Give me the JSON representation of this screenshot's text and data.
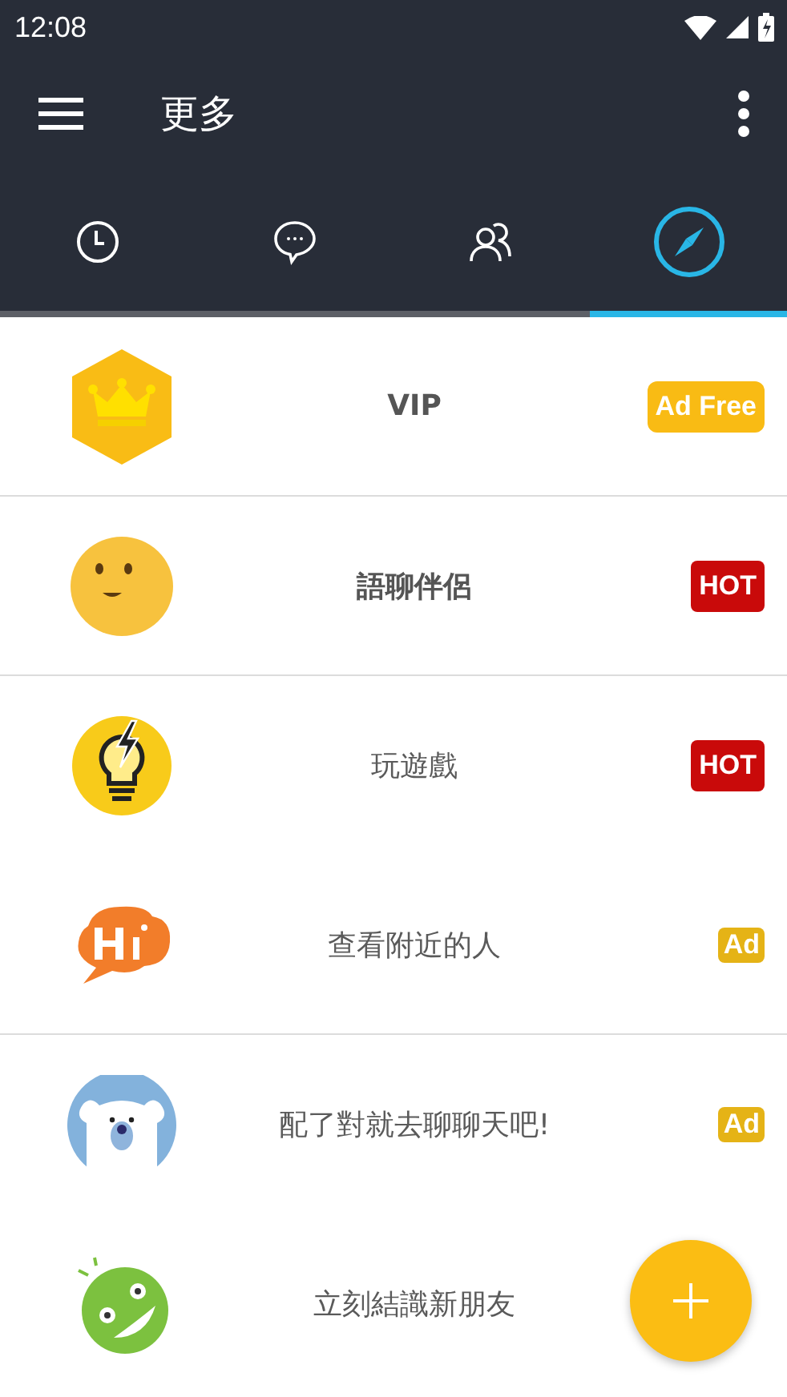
{
  "status_bar": {
    "time": "12:08"
  },
  "toolbar": {
    "title": "更多"
  },
  "tabs": [
    {
      "selected": false
    },
    {
      "selected": false
    },
    {
      "selected": false
    },
    {
      "selected": true
    }
  ],
  "rows": [
    {
      "label": "VIP",
      "bold": true,
      "badge": {
        "kind": "adfree",
        "text": "Ad Free"
      },
      "divider": true
    },
    {
      "label": "語聊伴侶",
      "bold": true,
      "badge": {
        "kind": "hot",
        "text": "HOT"
      },
      "divider": true
    },
    {
      "label": "玩遊戲",
      "bold": false,
      "badge": {
        "kind": "hot",
        "text": "HOT"
      },
      "divider": false
    },
    {
      "label": "查看附近的人",
      "bold": false,
      "badge": {
        "kind": "ad",
        "text": "Ad"
      },
      "divider": true
    },
    {
      "label": "配了對就去聊聊天吧!",
      "bold": false,
      "badge": {
        "kind": "ad",
        "text": "Ad"
      },
      "divider": false
    },
    {
      "label": "立刻結識新朋友",
      "bold": false,
      "divider": false
    }
  ]
}
